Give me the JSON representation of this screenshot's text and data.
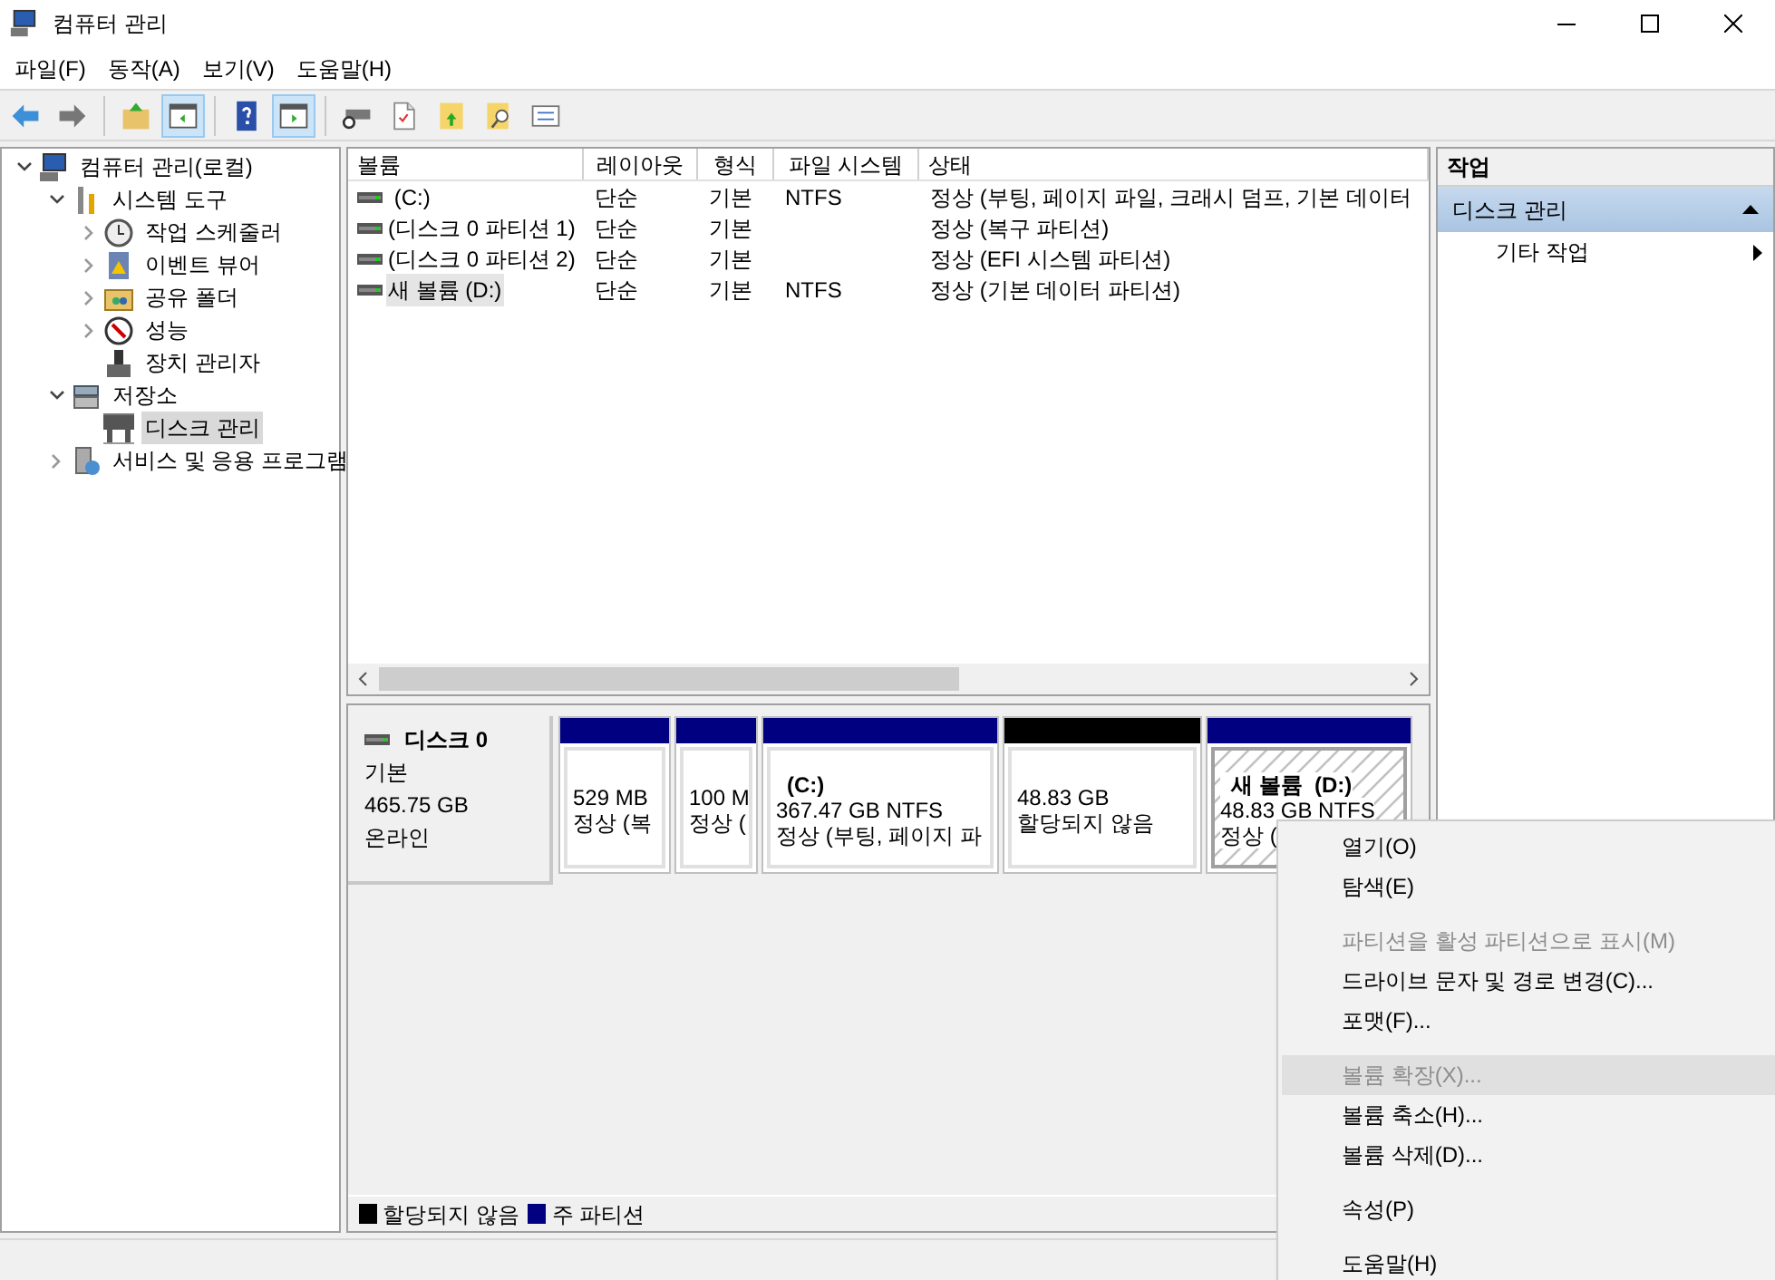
{
  "window": {
    "title": "컴퓨터 관리"
  },
  "menu_bar": [
    "파일(F)",
    "동작(A)",
    "보기(V)",
    "도움말(H)"
  ],
  "toolbar": [
    [
      {
        "kind": "back",
        "selected": false
      },
      {
        "kind": "forward",
        "selected": false
      }
    ],
    [
      {
        "kind": "up",
        "selected": false
      },
      {
        "kind": "pane",
        "selected": true
      }
    ],
    [
      {
        "kind": "help",
        "selected": false
      },
      {
        "kind": "pane2",
        "selected": true
      }
    ],
    [
      {
        "kind": "disk",
        "selected": false
      },
      {
        "kind": "check",
        "selected": false
      },
      {
        "kind": "folder-up",
        "selected": false
      },
      {
        "kind": "search",
        "selected": false
      },
      {
        "kind": "list",
        "selected": false
      }
    ]
  ],
  "tree": [
    {
      "label": "컴퓨터 관리(로컬)",
      "kind": "computer",
      "expanded": true,
      "selected": false,
      "children": [
        {
          "label": "시스템 도구",
          "kind": "tools",
          "expanded": true,
          "selected": false,
          "children": [
            {
              "label": "작업 스케줄러",
              "kind": "clock",
              "expanded": false,
              "selected": false
            },
            {
              "label": "이벤트 뷰어",
              "kind": "log",
              "expanded": false,
              "selected": false
            },
            {
              "label": "공유 폴더",
              "kind": "folder",
              "expanded": false,
              "selected": false
            },
            {
              "label": "성능",
              "kind": "gauge",
              "expanded": false,
              "selected": false
            },
            {
              "label": "장치 관리자",
              "kind": "device",
              "selected": false
            }
          ]
        },
        {
          "label": "저장소",
          "kind": "storage",
          "expanded": true,
          "selected": false,
          "children": [
            {
              "label": "디스크 관리",
              "kind": "disk",
              "selected": true
            }
          ]
        },
        {
          "label": "서비스 및 응용 프로그램",
          "kind": "services",
          "expanded": false,
          "selected": false
        }
      ]
    }
  ],
  "volume_table": {
    "columns": [
      "볼륨",
      "레이아웃",
      "형식",
      "파일 시스템",
      "상태"
    ],
    "rows": [
      {
        "volume": " (C:)",
        "layout": "단순",
        "type": "기본",
        "file_system": "NTFS",
        "status": "정상 (부팅, 페이지 파일, 크래시 덤프, 기본 데이터",
        "selected": false
      },
      {
        "volume": "(디스크 0 파티션 1)",
        "layout": "단순",
        "type": "기본",
        "status": "정상 (복구 파티션)",
        "selected": false
      },
      {
        "volume": "(디스크 0 파티션 2)",
        "layout": "단순",
        "type": "기본",
        "status": "정상 (EFI 시스템 파티션)",
        "selected": false
      },
      {
        "volume": "새 볼륨 (D:)",
        "layout": "단순",
        "type": "기본",
        "file_system": "NTFS",
        "status": "정상 (기본 데이터 파티션)",
        "selected": true
      }
    ]
  },
  "disk": {
    "name": "디스크 0",
    "type": "기본",
    "size": "465.75 GB",
    "status": "온라인",
    "partitions": [
      {
        "kind": "primary",
        "size": "529 MB",
        "status": "정상 (복",
        "selected": false
      },
      {
        "kind": "primary",
        "size": "100 M",
        "status": "정상 (",
        "selected": false
      },
      {
        "kind": "primary",
        "label": "(C:)",
        "size": "367.47 GB NTFS",
        "status": "정상 (부팅, 페이지 파",
        "selected": false
      },
      {
        "kind": "unallocated",
        "size": "48.83 GB",
        "status": "할당되지 않음",
        "selected": false
      },
      {
        "kind": "primary",
        "label": "새 볼륨  (D:)",
        "size": "48.83 GB NTFS",
        "status": "정상 (",
        "selected": true
      }
    ]
  },
  "legend": [
    {
      "label": "할당되지 않음",
      "color": "#000000"
    },
    {
      "label": "주 파티션",
      "color": "#000080"
    }
  ],
  "actions": {
    "title": "작업",
    "section": {
      "label": "디스크 관리",
      "expanded": true
    },
    "items": [
      "기타 작업"
    ]
  },
  "context_menu": [
    {
      "kind": "item",
      "label": "열기(O)",
      "disabled": false,
      "selected": false
    },
    {
      "kind": "item",
      "label": "탐색(E)",
      "disabled": false,
      "selected": false
    },
    {
      "kind": "separator"
    },
    {
      "kind": "item",
      "label": "파티션을 활성 파티션으로 표시(M)",
      "disabled": true,
      "selected": false
    },
    {
      "kind": "item",
      "label": "드라이브 문자 및 경로 변경(C)...",
      "disabled": false,
      "selected": false
    },
    {
      "kind": "item",
      "label": "포맷(F)...",
      "disabled": false,
      "selected": false
    },
    {
      "kind": "separator"
    },
    {
      "kind": "item",
      "label": "볼륨 확장(X)...",
      "disabled": true,
      "selected": true
    },
    {
      "kind": "item",
      "label": "볼륨 축소(H)...",
      "disabled": false,
      "selected": false
    },
    {
      "kind": "item",
      "label": "볼륨 삭제(D)...",
      "disabled": false,
      "selected": false
    },
    {
      "kind": "separator"
    },
    {
      "kind": "item",
      "label": "속성(P)",
      "disabled": false,
      "selected": false
    },
    {
      "kind": "separator"
    },
    {
      "kind": "item",
      "label": "도움말(H)",
      "disabled": false,
      "selected": false
    }
  ]
}
